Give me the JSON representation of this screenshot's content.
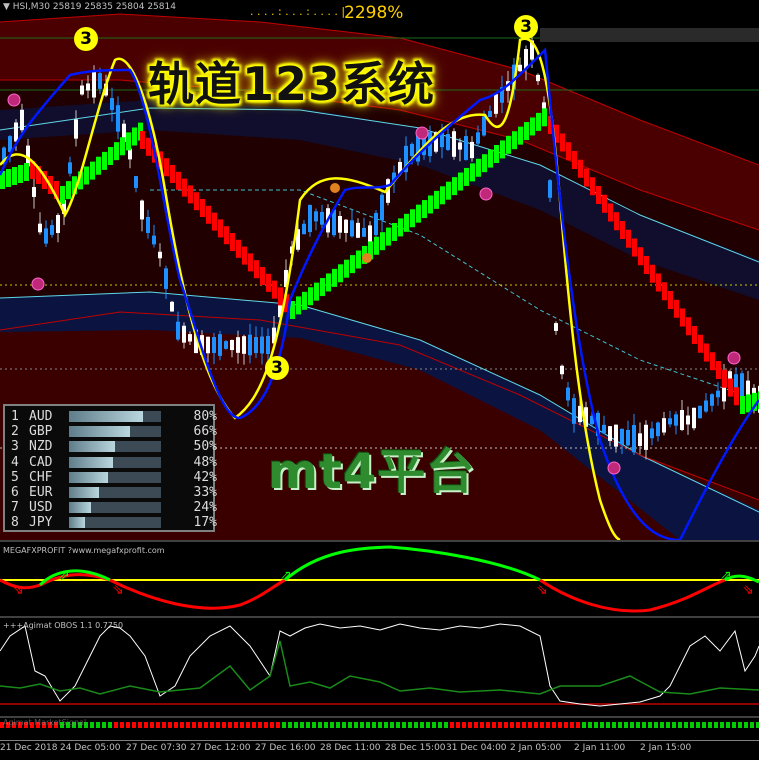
{
  "header": {
    "symbol_line": "▼ HSI,M30  25819 25835 25804 25814",
    "progress_dots": ". . . . : . . . : . . . . |",
    "progress_percent": "2298%"
  },
  "title": "轨道123系统",
  "watermark": "mt4平台",
  "labels": {
    "marker": "3"
  },
  "strength_panel": {
    "rows": [
      {
        "rank": "1",
        "currency": "AUD",
        "percent": "80%",
        "level": 0.8
      },
      {
        "rank": "2",
        "currency": "GBP",
        "percent": "66%",
        "level": 0.66
      },
      {
        "rank": "3",
        "currency": "NZD",
        "percent": "50%",
        "level": 0.5
      },
      {
        "rank": "4",
        "currency": "CAD",
        "percent": "48%",
        "level": 0.48
      },
      {
        "rank": "5",
        "currency": "CHF",
        "percent": "42%",
        "level": 0.42
      },
      {
        "rank": "6",
        "currency": "EUR",
        "percent": "33%",
        "level": 0.33
      },
      {
        "rank": "7",
        "currency": "USD",
        "percent": "24%",
        "level": 0.24
      },
      {
        "rank": "8",
        "currency": "JPY",
        "percent": "17%",
        "level": 0.17
      }
    ]
  },
  "indicators": {
    "ind1_name": "MEGAFXPROFIT ?www.megafxprofit.com",
    "ind2_name": "+++Agimat OBOS 1.1 0.7750",
    "ind3_name": "Agimat MarketSignal"
  },
  "time_axis": {
    "labels": [
      "21 Dec 2018",
      "24 Dec 05:00",
      "27 Dec 07:30",
      "27 Dec 12:00",
      "27 Dec 16:00",
      "28 Dec 11:00",
      "28 Dec 15:00",
      "31 Dec 04:00",
      "2 Jan 05:00",
      "2 Jan 11:00",
      "2 Jan 15:00"
    ]
  },
  "colors": {
    "bull_candle": "#1e90ff",
    "bear_candle": "#ff0000",
    "trend_up": "#00ff00",
    "trend_down": "#ff0000",
    "channel_fill": "#3a0000",
    "center_band": "#0b1440",
    "fast_line": "#ffff00",
    "slow_line": "#0000ff",
    "accent_text": "#ffd000"
  },
  "icons": {
    "arrow_up": "green-up-arrow-icon",
    "arrow_down": "red-down-arrow-icon",
    "signal_dot": "magenta-dot-icon"
  }
}
